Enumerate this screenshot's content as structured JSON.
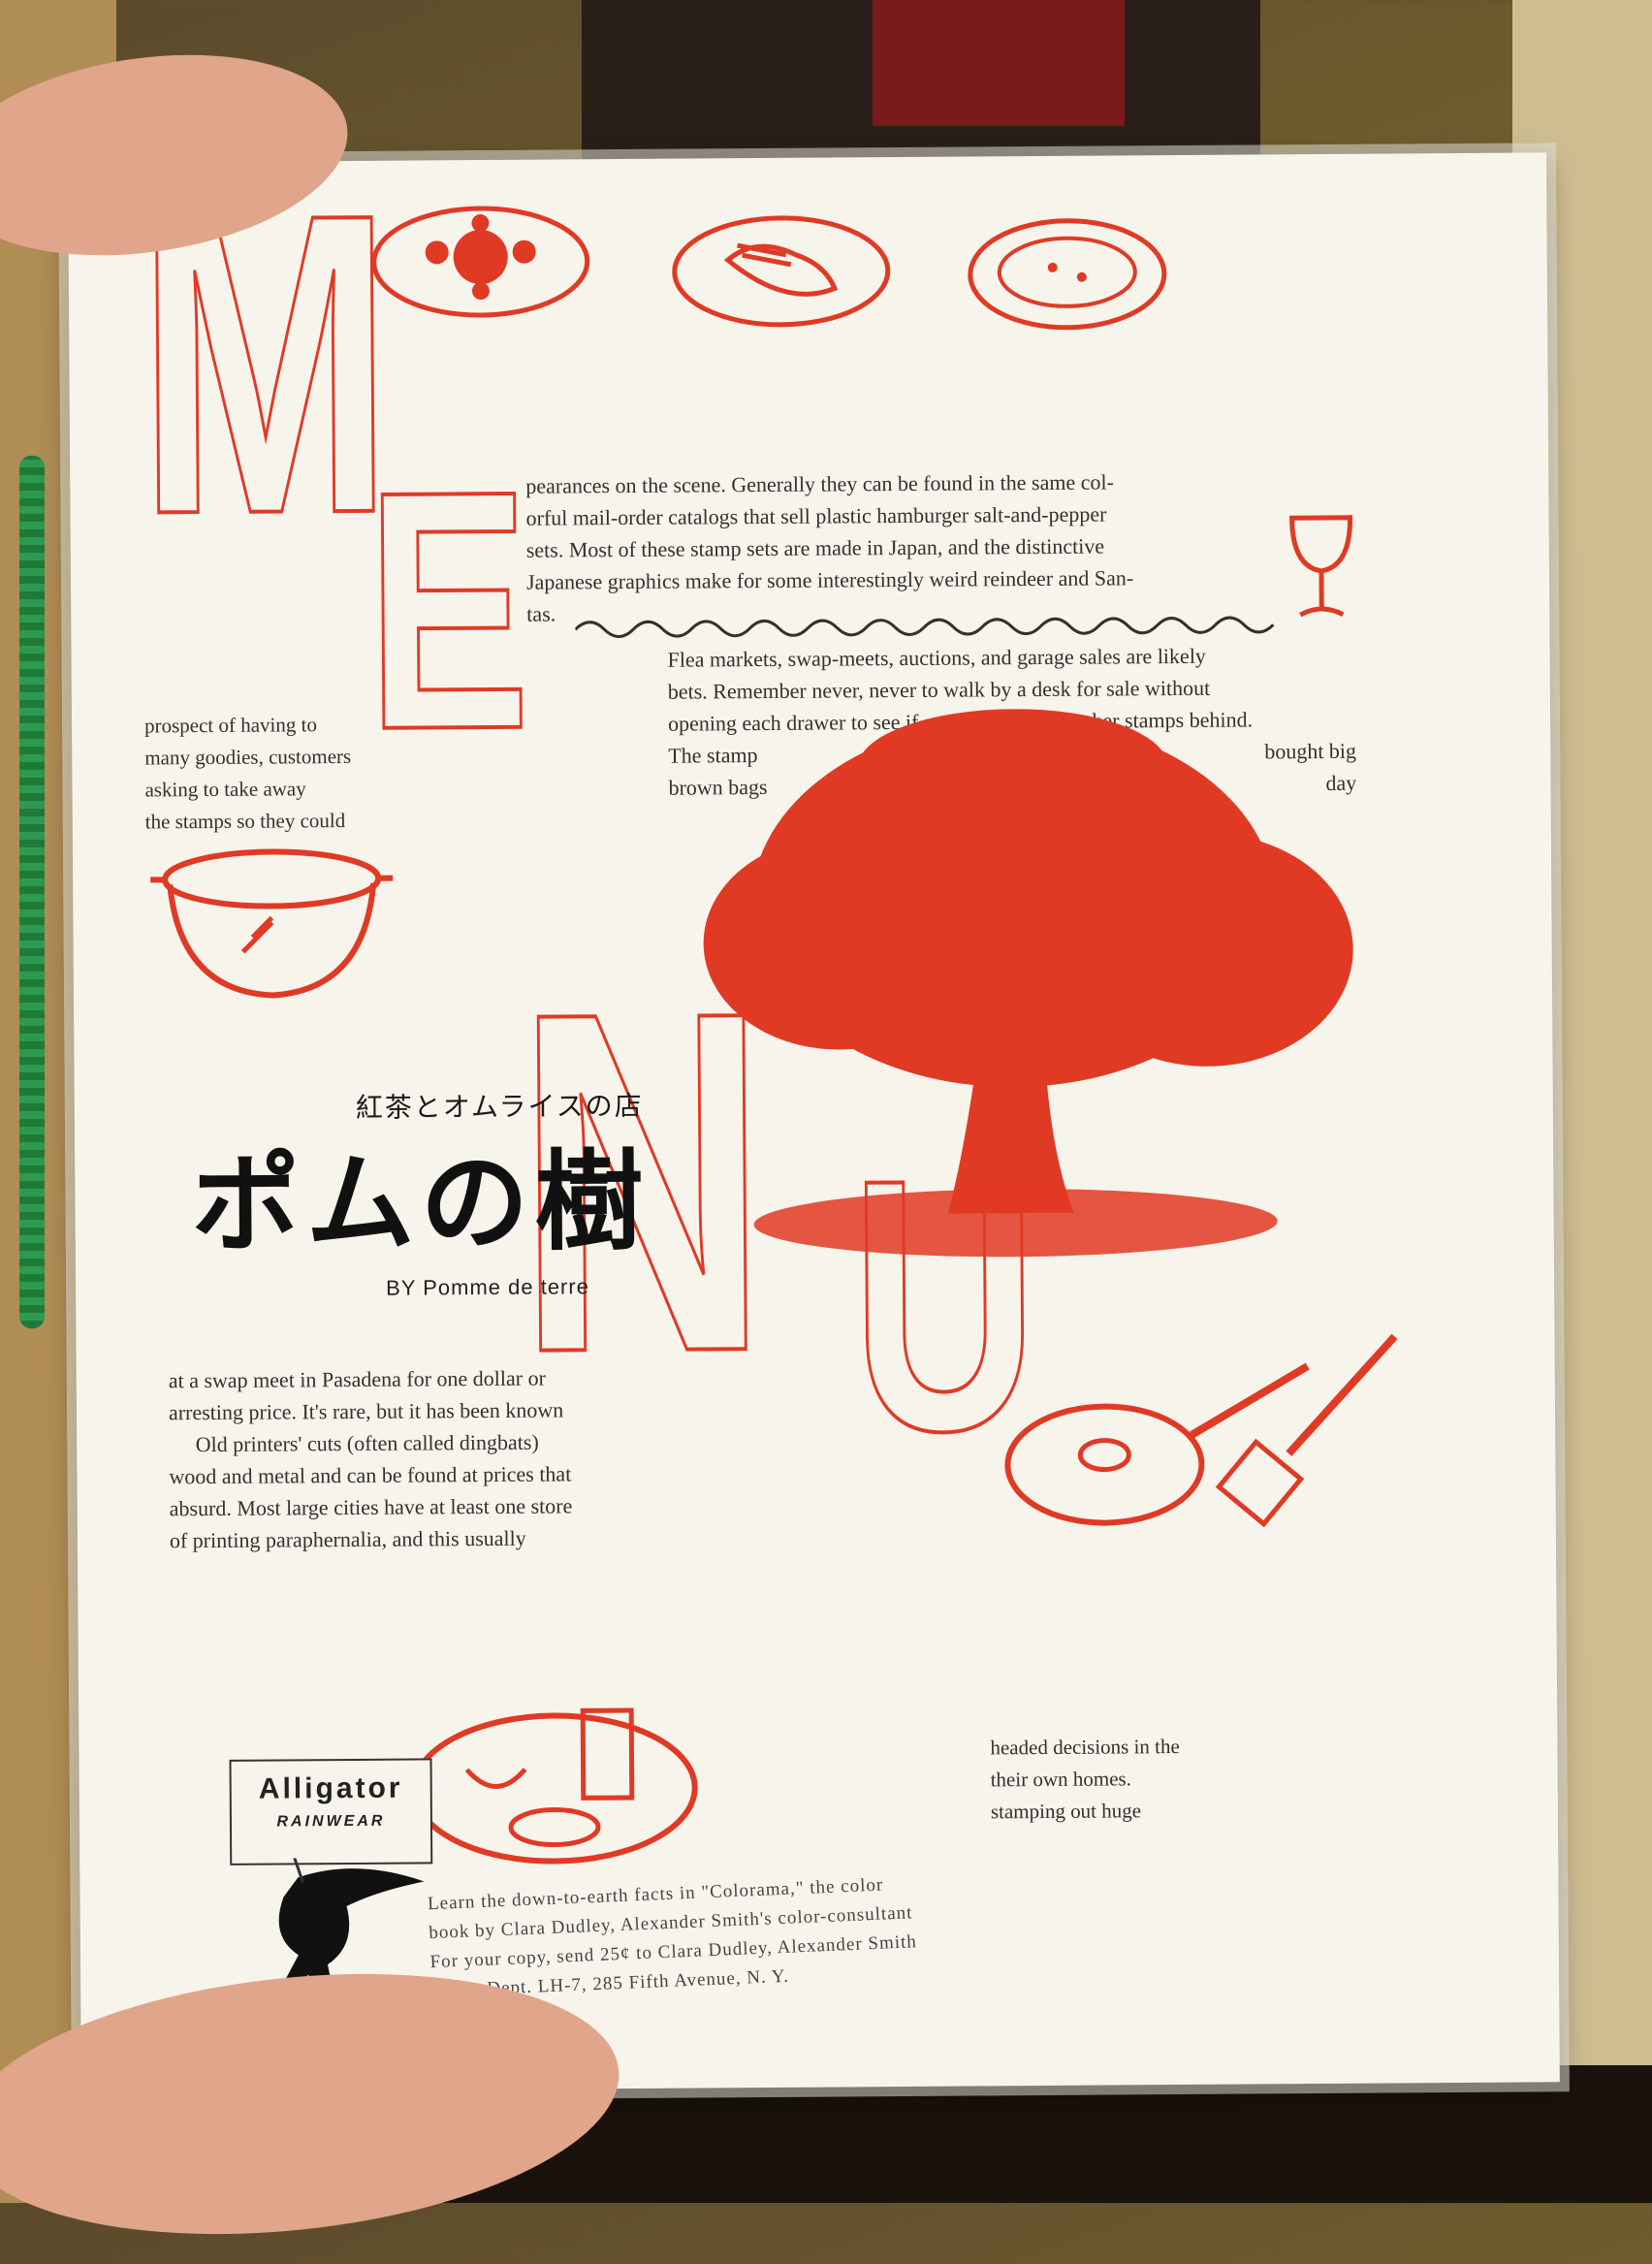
{
  "menu_letters": {
    "m": "M",
    "e": "E",
    "n": "N",
    "u": "U"
  },
  "copy": {
    "block1": "pearances on the scene. Generally they can be found in the same col-\norful mail-order catalogs that sell plastic hamburger salt-and-pepper\nsets. Most of these stamp sets are made in Japan, and the distinctive\nJapanese graphics make for some interestingly weird reindeer and San-\ntas.",
    "block2": "Flea markets, swap-meets, auctions, and garage sales are likely\nbets. Remember never, never to walk by a desk for sale without\nopening each drawer to see if someone left his or her stamps behind.",
    "block2_left": "The stamp\nbrown bags",
    "block2_right": "bought big\nday",
    "left_col": "prospect of having to\nmany goodies, customers\nasking to take away\nthe stamps so they could",
    "block3": "at a swap meet in Pasadena for one dollar or\narresting price. It's rare, but it has been known\n     Old printers' cuts (often called dingbats)\nwood and metal and can be found at prices that\nabsurd. Most large cities have at least one store\nof printing paraphernalia, and this usually",
    "block4": "headed decisions in the\ntheir own homes.\nstamping out huge"
  },
  "shop": {
    "subtitle": "紅茶とオムライスの店",
    "name": "ポムの樹",
    "byline": "BY Pomme de terre"
  },
  "ad": {
    "brand": "Alligator",
    "sub": "RAINWEAR",
    "copy": "Learn the down-to-earth facts in \"Colorama,\" the color\nbook by Clara Dudley, Alexander Smith's color-consultant\nFor your copy, send 25¢ to Clara Dudley, Alexander Smith\nS        Dept. LH-7, 285 Fifth Avenue, N. Y."
  },
  "colors": {
    "accent_red": "#e03a25",
    "ink": "#3a2e2a",
    "paper": "#f7f4ec",
    "cord_green": "#1f7a3a"
  }
}
